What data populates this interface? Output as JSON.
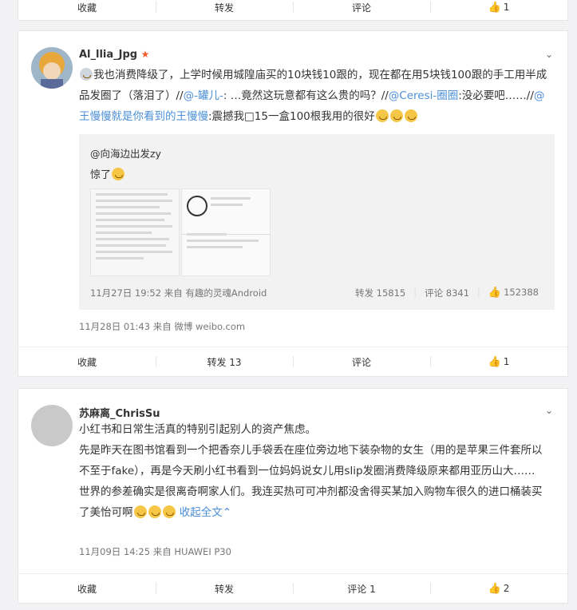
{
  "top_actions": {
    "collect": "收藏",
    "forward": "转发",
    "comment": "评论",
    "like_count": "1"
  },
  "post1": {
    "username": "Al_llia_Jpg",
    "badge": "★",
    "text_a": "我也消费降级了，上学时候用城隍庙买的10块钱10跟的，现在都在用5块钱100跟的手工用半成品发圈了（落泪了）//",
    "mention1": "@-罐儿-",
    "text_b": ": …竟然这玩意都有这么贵的吗？//",
    "mention2": "@Ceresi-圈圈",
    "text_c": ":没必要吧……//",
    "mention3": "@王慢慢就是你看到的王慢慢",
    "text_d": ":震撼我□15一盒100根我用的很好",
    "repost": {
      "user": "@向海边出发zy",
      "text": "惊了",
      "meta": "11月27日 19:52 来自 有趣的灵魂Android",
      "forward": "转发 15815",
      "comment": "评论 8341",
      "likes": "152388"
    },
    "meta": "11月28日 01:43 来自 微博 weibo.com",
    "actions": {
      "collect": "收藏",
      "forward": "转发 13",
      "comment": "评论",
      "like_count": "1"
    }
  },
  "post2": {
    "username": "苏麻离_ChrisSu",
    "p1": "小红书和日常生活真的特别引起别人的资产焦虑。",
    "p2": "先是昨天在图书馆看到一个把香奈儿手袋丢在座位旁边地下装杂物的女生（用的是苹果三件套所以不至于fake），再是今天刷小红书看到一位妈妈说女儿用slip发圈消费降级原来都用亚历山大……",
    "p3": "世界的参差确实是很离奇啊家人们。我连买热可可冲剂都没舍得买某加入购物车很久的进口桶装买了美怡可啊",
    "collapse": "收起全文",
    "meta": "11月09日 14:25 来自 HUAWEI P30",
    "actions": {
      "collect": "收藏",
      "forward": "转发",
      "comment": "评论 1",
      "like_count": "2"
    }
  },
  "icons": {
    "more": "chevron-down-icon",
    "like": "thumb-up-icon"
  }
}
